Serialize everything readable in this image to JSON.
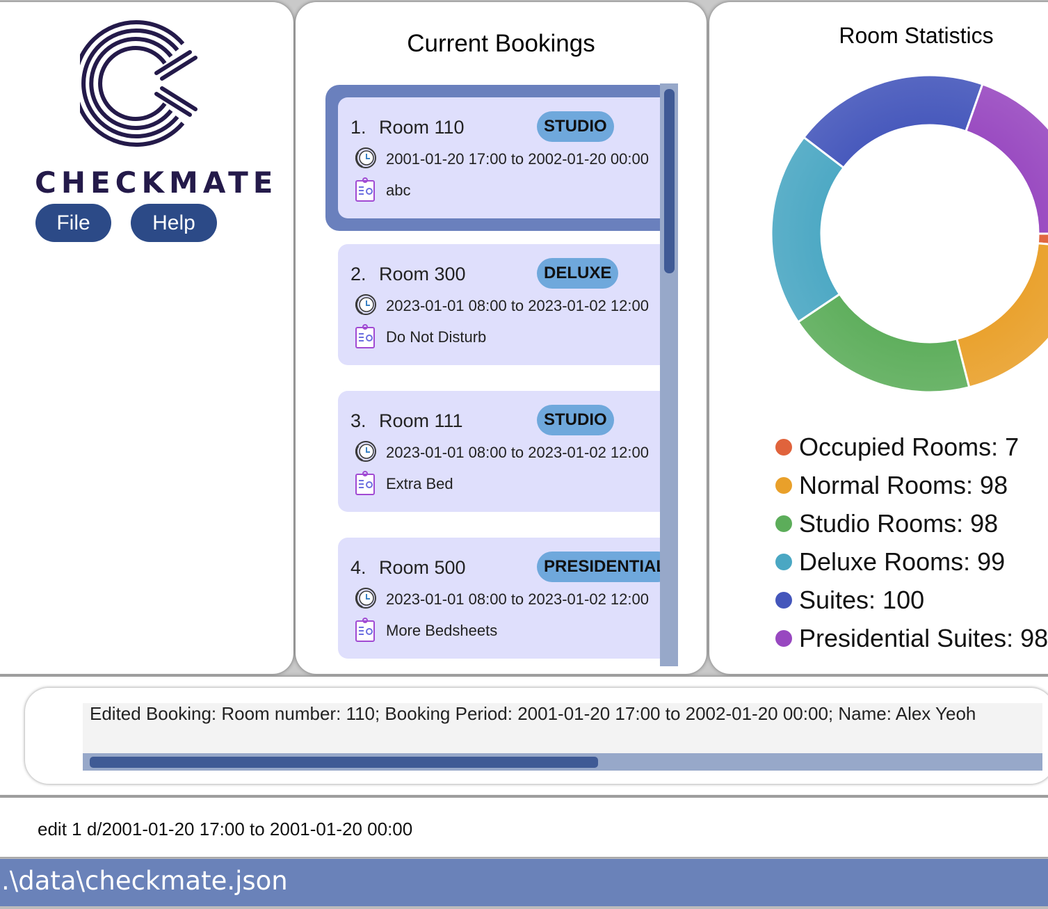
{
  "app": {
    "brand": "CHECKMATE",
    "menu": {
      "file_label": "File",
      "help_label": "Help"
    }
  },
  "bookings": {
    "title": "Current Bookings",
    "items": [
      {
        "index": "1.",
        "room": "Room 110",
        "type": "STUDIO",
        "period": "2001-01-20 17:00 to 2002-01-20 00:00",
        "remark": "abc",
        "selected": true
      },
      {
        "index": "2.",
        "room": "Room 300",
        "type": "DELUXE",
        "period": "2023-01-01 08:00 to 2023-01-02 12:00",
        "remark": "Do Not Disturb",
        "selected": false
      },
      {
        "index": "3.",
        "room": "Room 111",
        "type": "STUDIO",
        "period": "2023-01-01 08:00 to 2023-01-02 12:00",
        "remark": "Extra Bed",
        "selected": false
      },
      {
        "index": "4.",
        "room": "Room 500",
        "type": "PRESIDENTIAL",
        "period": "2023-01-01 08:00 to 2023-01-02 12:00",
        "remark": "More Bedsheets",
        "selected": false
      }
    ]
  },
  "stats": {
    "title": "Room Statistics",
    "legend": [
      {
        "label": "Occupied Rooms: 7",
        "color": "#e0633c"
      },
      {
        "label": "Normal Rooms: 98",
        "color": "#e9a02a"
      },
      {
        "label": "Studio Rooms: 98",
        "color": "#5cad5a"
      },
      {
        "label": "Deluxe Rooms: 99",
        "color": "#4aa7c3"
      },
      {
        "label": "Suites: 100",
        "color": "#4456bb"
      },
      {
        "label": "Presidential Suites: 98",
        "color": "#9848c0"
      }
    ]
  },
  "chart_data": {
    "type": "pie",
    "categories": [
      "Occupied Rooms",
      "Normal Rooms",
      "Studio Rooms",
      "Deluxe Rooms",
      "Suites",
      "Presidential Suites"
    ],
    "values": [
      7,
      98,
      98,
      99,
      100,
      98
    ],
    "title": "Room Statistics"
  },
  "result": {
    "text": "Edited Booking: Room number: 110; Booking Period: 2001-01-20 17:00 to 2002-01-20 00:00; Name: Alex Yeoh"
  },
  "command": {
    "text": "edit 1 d/2001-01-20 17:00 to 2001-01-20 00:00"
  },
  "status": {
    "path": ".\\data\\checkmate.json"
  }
}
